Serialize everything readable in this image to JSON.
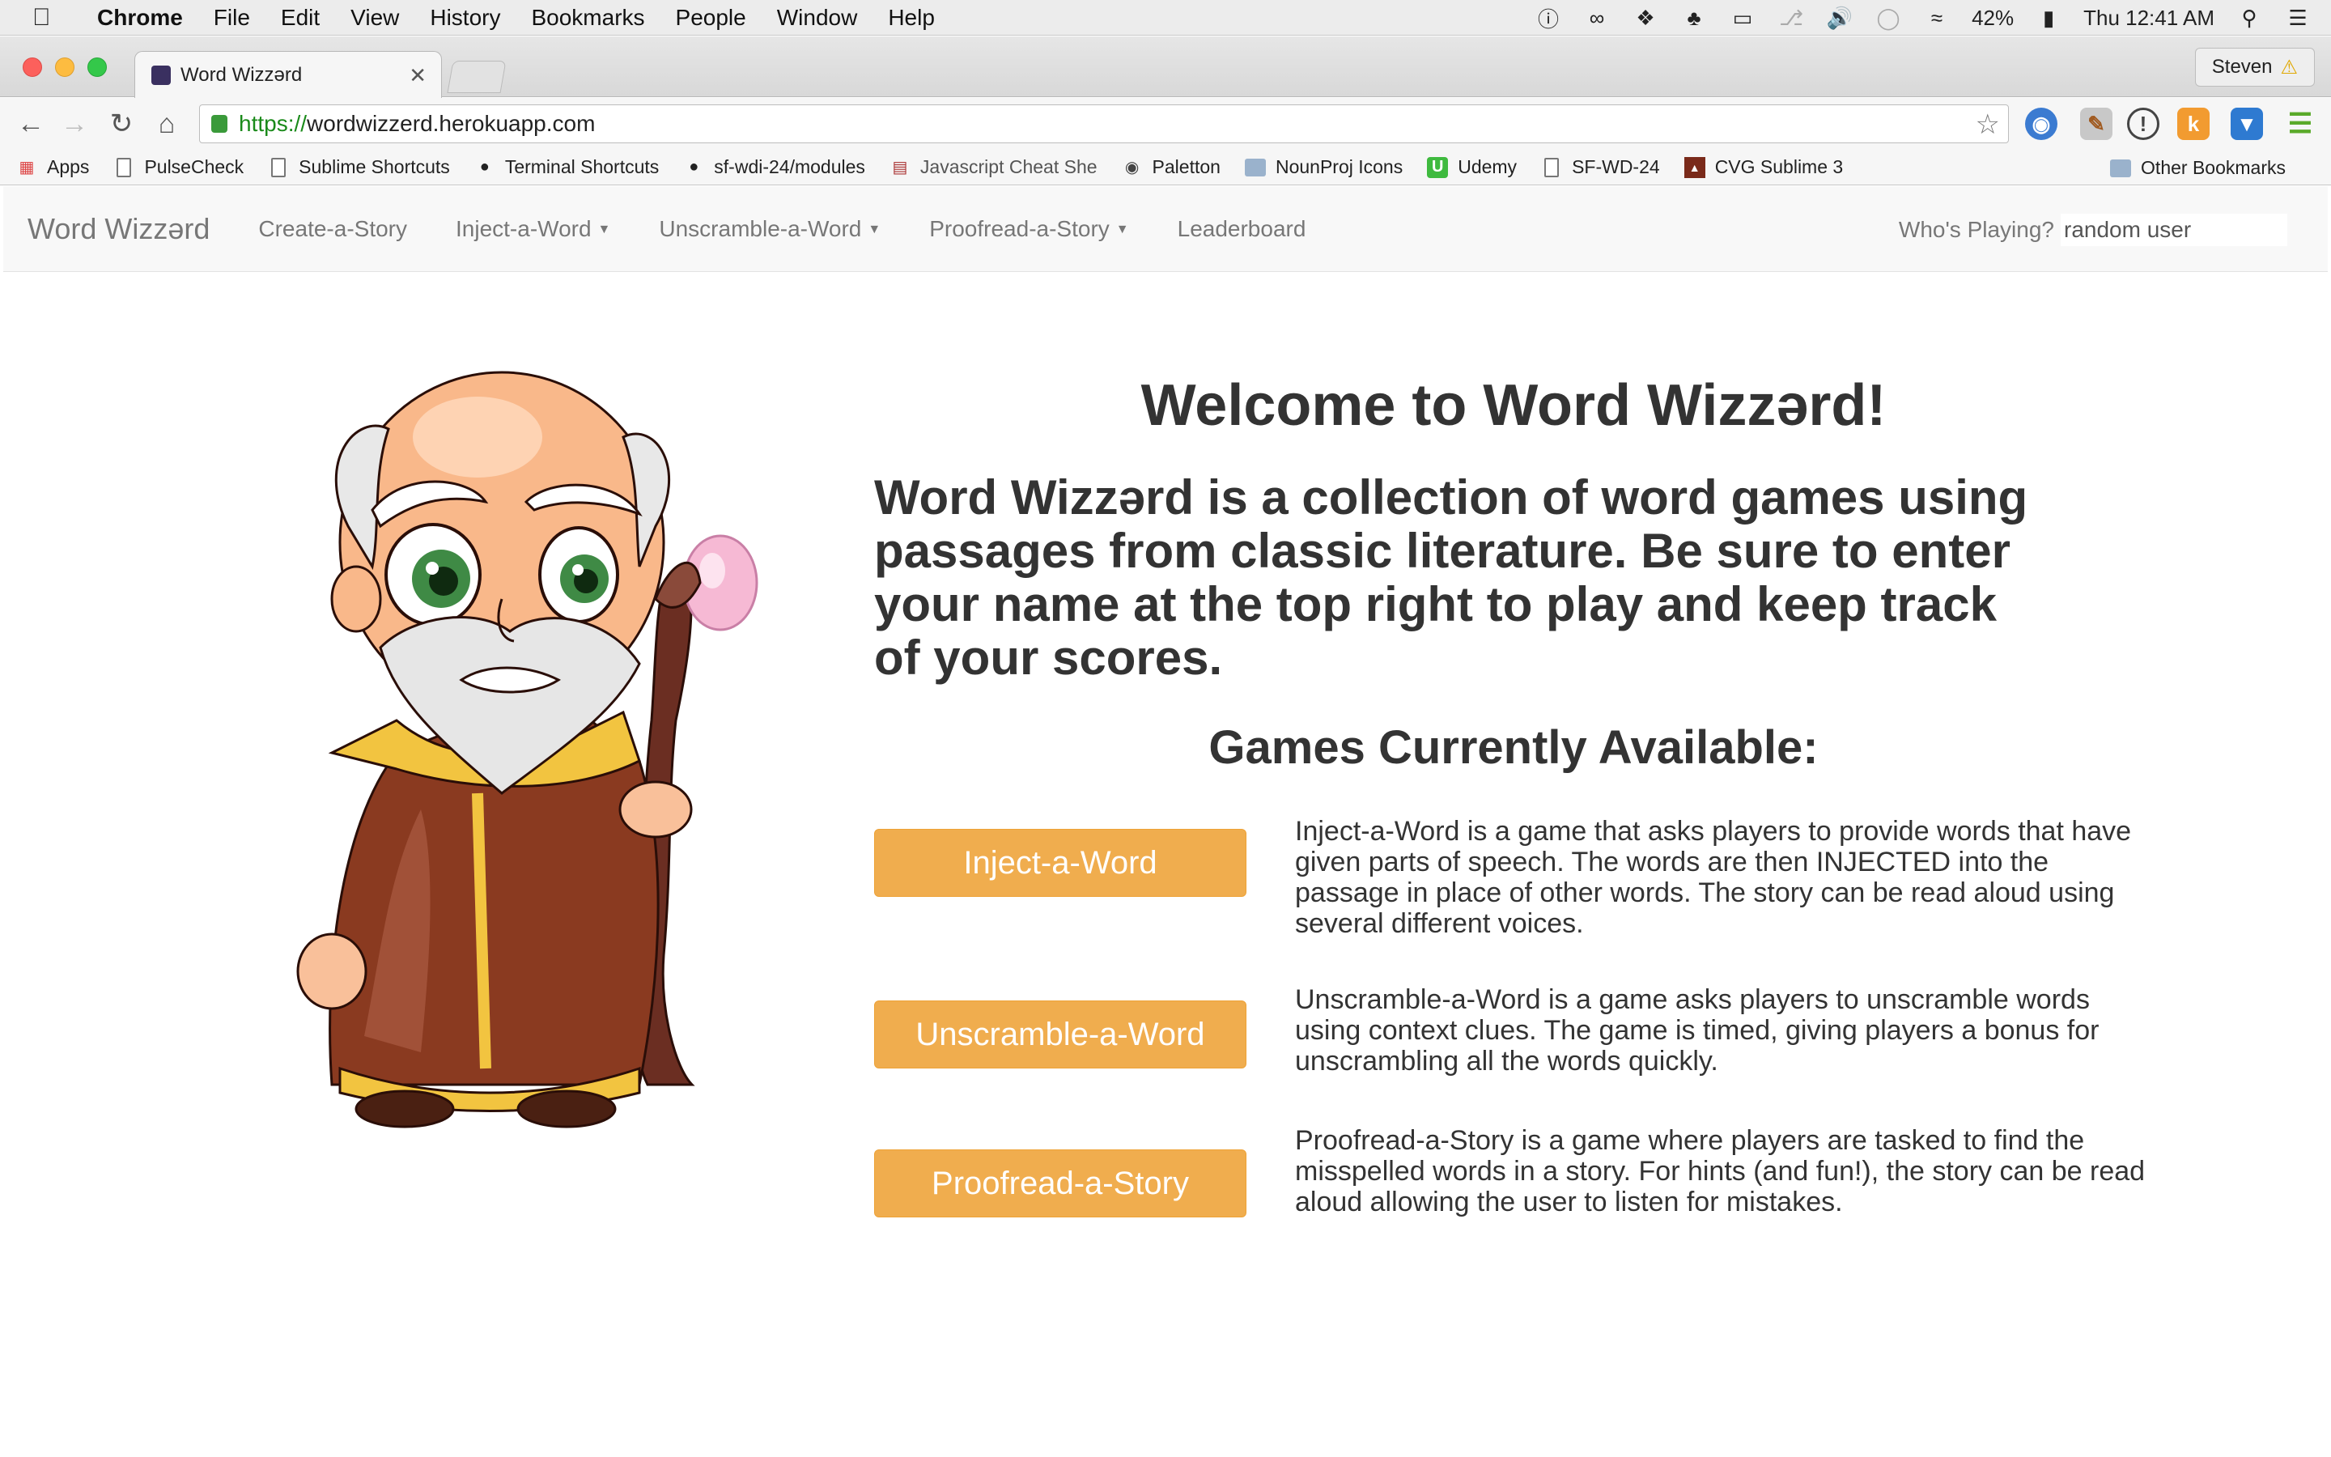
{
  "menubar": {
    "app": "Chrome",
    "items": [
      "File",
      "Edit",
      "View",
      "History",
      "Bookmarks",
      "People",
      "Window",
      "Help"
    ],
    "battery": "42%",
    "clock": "Thu 12:41 AM"
  },
  "browser": {
    "tab_title": "Word Wizzərd",
    "profile": "Steven",
    "url_scheme": "https://",
    "url_rest": "wordwizzerd.herokuapp.com",
    "bookmarks": [
      {
        "label": "Apps",
        "icon": "apps-grid-icon"
      },
      {
        "label": "PulseCheck",
        "icon": "page-icon"
      },
      {
        "label": "Sublime Shortcuts",
        "icon": "page-icon"
      },
      {
        "label": "Terminal Shortcuts",
        "icon": "github-icon"
      },
      {
        "label": "sf-wdi-24/modules",
        "icon": "github-icon"
      },
      {
        "label": "Javascript Cheat She",
        "icon": "book-icon"
      },
      {
        "label": "Paletton",
        "icon": "paletton-icon"
      },
      {
        "label": "NounProj Icons",
        "icon": "folder-icon"
      },
      {
        "label": "Udemy",
        "icon": "udemy-icon"
      },
      {
        "label": "SF-WD-24",
        "icon": "page-icon"
      },
      {
        "label": "CVG Sublime 3",
        "icon": "cvg-icon"
      }
    ],
    "bookmarks_more": "»",
    "other_bookmarks": "Other Bookmarks"
  },
  "site": {
    "brand": "Word Wizzərd",
    "nav": [
      {
        "label": "Create-a-Story",
        "dropdown": false
      },
      {
        "label": "Inject-a-Word",
        "dropdown": true
      },
      {
        "label": "Unscramble-a-Word",
        "dropdown": true
      },
      {
        "label": "Proofread-a-Story",
        "dropdown": true
      },
      {
        "label": "Leaderboard",
        "dropdown": false
      }
    ],
    "who_label": "Who's Playing?",
    "who_value": "random user"
  },
  "main": {
    "welcome": "Welcome to Word Wizzərd!",
    "intro": "Word Wizzərd is a collection of word games using passages from classic literature. Be sure to enter your name at the top right to play and keep track of your scores.",
    "games_title": "Games Currently Available:",
    "games": [
      {
        "button": "Inject-a-Word",
        "description": "Inject-a-Word is a game that asks players to provide words that have given parts of speech. The words are then INJECTED into the passage in place of other words. The story can be read aloud using several different voices."
      },
      {
        "button": "Unscramble-a-Word",
        "description": "Unscramble-a-Word is a game asks players to unscramble words using context clues. The game is timed, giving players a bonus for unscrambling all the words quickly."
      },
      {
        "button": "Proofread-a-Story",
        "description": "Proofread-a-Story is a game where players are tasked to find the misspelled words in a story. For hints (and fun!), the story can be read aloud allowing the user to listen for mistakes."
      }
    ]
  },
  "colors": {
    "button": "#f0ad4e",
    "navbar_bg": "#f8f8f8",
    "url_green": "#1a8a1a"
  }
}
